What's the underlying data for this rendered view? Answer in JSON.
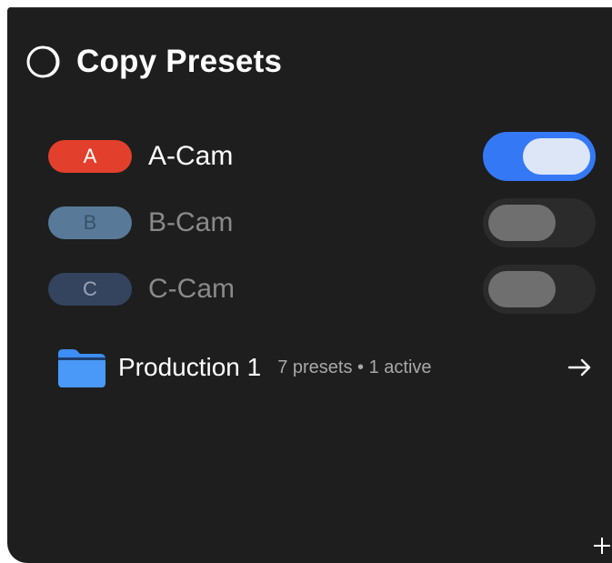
{
  "header": {
    "title": "Copy Presets",
    "icon": "copy-presets-logo-icon"
  },
  "cameras": [
    {
      "badge": "A",
      "label": "A-Cam",
      "enabled": true,
      "badge_color": "#e2402c",
      "badge_text_color": "#ffffff",
      "label_color": "#ffffff"
    },
    {
      "badge": "B",
      "label": "B-Cam",
      "enabled": false,
      "badge_color": "#587a98",
      "badge_text_color": "#3a5068",
      "label_color": "#8a8a8a"
    },
    {
      "badge": "C",
      "label": "C-Cam",
      "enabled": false,
      "badge_color": "#34445e",
      "badge_text_color": "#9aa4b4",
      "label_color": "#8a8a8a"
    }
  ],
  "folder": {
    "name": "Production 1",
    "meta": "7 presets • 1 active",
    "icon": "folder-icon",
    "action_icon": "arrow-right-icon"
  },
  "footer": {
    "add_icon": "plus-icon"
  },
  "colors": {
    "panel_bg": "#1e1e1e",
    "toggle_on": "#3478f6",
    "toggle_off": "#2b2b2b",
    "folder": "#3d8ef7"
  }
}
